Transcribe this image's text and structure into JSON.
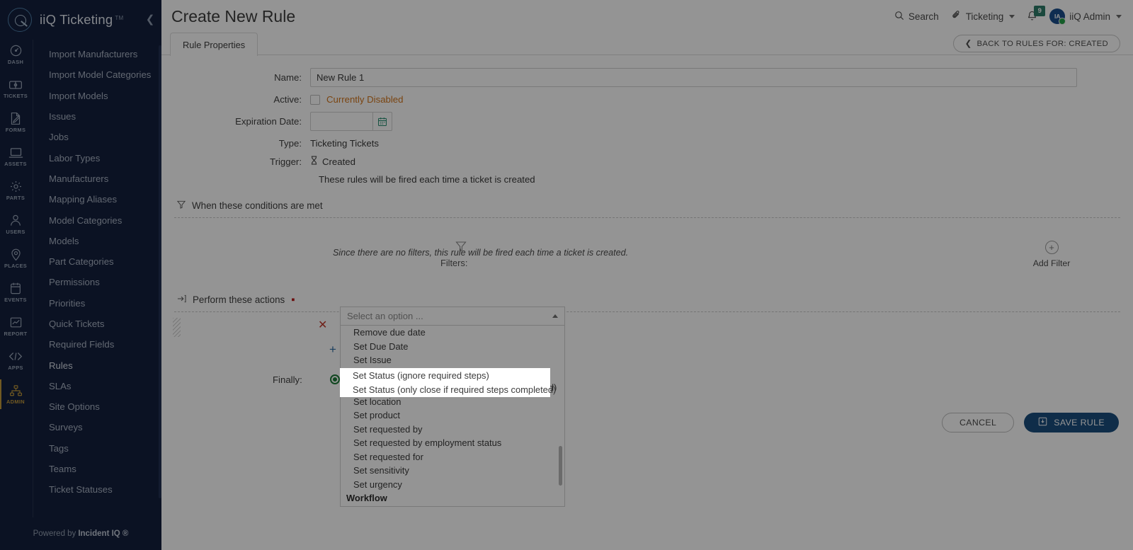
{
  "brand": {
    "name": "iiQ Ticketing",
    "tm": "TM",
    "collapse_icon": "chevron-left-icon"
  },
  "sidebar": {
    "rail": [
      {
        "label": "DASH",
        "icon": "dashboard-icon",
        "active": false
      },
      {
        "label": "TICKETS",
        "icon": "ticket-icon",
        "active": false
      },
      {
        "label": "FORMS",
        "icon": "form-edit-icon",
        "active": false
      },
      {
        "label": "ASSETS",
        "icon": "laptop-icon",
        "active": false
      },
      {
        "label": "PARTS",
        "icon": "gear-icon",
        "active": false
      },
      {
        "label": "USERS",
        "icon": "user-icon",
        "active": false
      },
      {
        "label": "PLACES",
        "icon": "map-pin-icon",
        "active": false
      },
      {
        "label": "EVENTS",
        "icon": "calendar-icon",
        "active": false
      },
      {
        "label": "REPORT",
        "icon": "chart-icon",
        "active": false
      },
      {
        "label": "APPS",
        "icon": "apps-icon",
        "active": false
      },
      {
        "label": "ADMIN",
        "icon": "sitemap-icon",
        "active": true
      }
    ],
    "items": [
      {
        "label": "Import Manufacturers"
      },
      {
        "label": "Import Model Categories"
      },
      {
        "label": "Import Models"
      },
      {
        "label": "Issues"
      },
      {
        "label": "Jobs"
      },
      {
        "label": "Labor Types"
      },
      {
        "label": "Manufacturers"
      },
      {
        "label": "Mapping Aliases"
      },
      {
        "label": "Model Categories"
      },
      {
        "label": "Models"
      },
      {
        "label": "Part Categories"
      },
      {
        "label": "Permissions"
      },
      {
        "label": "Priorities"
      },
      {
        "label": "Quick Tickets"
      },
      {
        "label": "Required Fields"
      },
      {
        "label": "Rules"
      },
      {
        "label": "SLAs"
      },
      {
        "label": "Site Options"
      },
      {
        "label": "Surveys"
      },
      {
        "label": "Tags"
      },
      {
        "label": "Teams"
      },
      {
        "label": "Ticket Statuses"
      }
    ],
    "footer_prefix": "Powered by ",
    "footer_brand": "Incident IQ ®"
  },
  "topbar": {
    "page_title": "Create New Rule",
    "search_label": "Search",
    "search_icon": "search-icon",
    "product_label": "Ticketing",
    "product_icon": "paperclip-icon",
    "bell_icon": "bell-icon",
    "notification_count": "9",
    "avatar_initials": "IA",
    "user_label": "iiQ Admin"
  },
  "tabs": {
    "rule_properties": "Rule Properties",
    "back_button": "BACK TO RULES FOR: CREATED",
    "back_icon": "chevron-left-icon"
  },
  "form": {
    "name_label": "Name:",
    "name_value": "New Rule 1",
    "active_label": "Active:",
    "active_status": "Currently Disabled",
    "active_checked": false,
    "expiration_label": "Expiration Date:",
    "expiration_value": "",
    "calendar_icon": "calendar-icon",
    "type_label": "Type:",
    "type_value": "Ticketing Tickets",
    "trigger_label": "Trigger:",
    "trigger_icon": "hourglass-icon",
    "trigger_value": "Created",
    "trigger_description": "These rules will be fired each time a ticket is created"
  },
  "conditions": {
    "heading": "When these conditions are met",
    "heading_icon": "filter-icon",
    "filters_label": "Filters:",
    "filters_icon": "filter-icon",
    "filters_note": "Since there are no filters, this rule will be fired each time a ticket is created.",
    "add_filter_label": "Add Filter",
    "add_filter_icon": "plus-circle-icon"
  },
  "actions": {
    "heading": "Perform these actions",
    "heading_icon": "arrow-into-bracket-icon",
    "required_marker": "·",
    "remove_icon": "close-icon",
    "add_icon": "plus-icon",
    "drag_handle_icon": "drag-handle-icon",
    "finally_label": "Finally:",
    "select": {
      "placeholder": "Select an option ...",
      "value": "",
      "caret_icon": "chevron-up-icon",
      "options": [
        {
          "label": "Remove due date",
          "group": false
        },
        {
          "label": "Set Due Date",
          "group": false
        },
        {
          "label": "Set Issue",
          "group": false
        },
        {
          "label": "Set Status (ignore required steps)",
          "group": false
        },
        {
          "label": "Set Status (only close if required steps completed)",
          "group": false
        },
        {
          "label": "Set location",
          "group": false
        },
        {
          "label": "Set product",
          "group": false
        },
        {
          "label": "Set requested by",
          "group": false
        },
        {
          "label": "Set requested by employment status",
          "group": false
        },
        {
          "label": "Set requested for",
          "group": false
        },
        {
          "label": "Set sensitivity",
          "group": false
        },
        {
          "label": "Set urgency",
          "group": false
        },
        {
          "label": "Workflow",
          "group": true
        }
      ],
      "highlighted": [
        "Set Status (ignore required steps)",
        "Set Status (only close if required steps completed)"
      ]
    }
  },
  "footer": {
    "cancel_label": "CANCEL",
    "save_label": "SAVE RULE",
    "save_icon": "save-disk-icon"
  },
  "colors": {
    "sidebar_bg": "#131f3d",
    "admin_accent": "#c39a3c",
    "warning_text": "#d3761c",
    "primary_button": "#1b4f7e",
    "danger": "#c0392b",
    "success": "#1c7a38",
    "badge_green": "#2e7d6a"
  }
}
